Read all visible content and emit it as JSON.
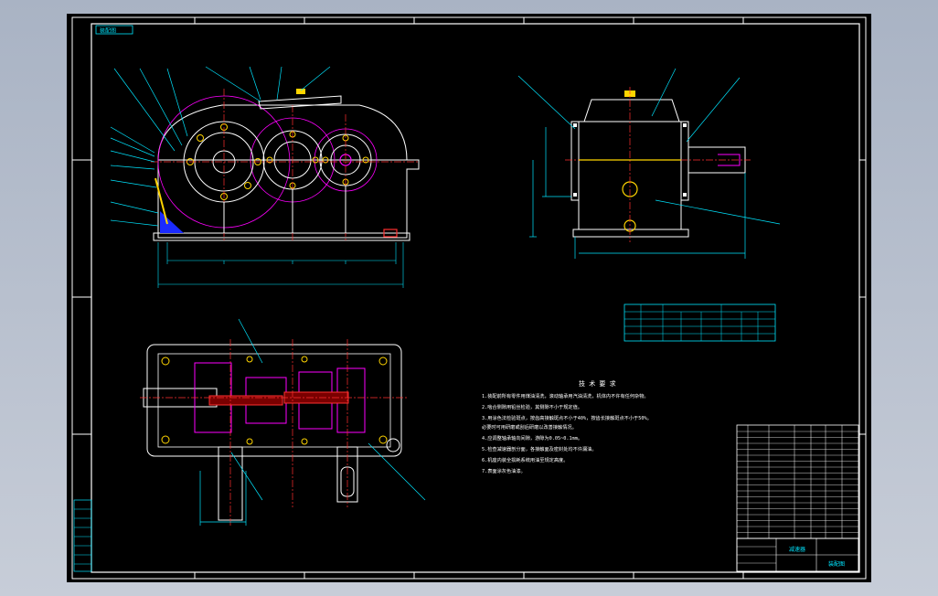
{
  "drawing": {
    "top_left_label": "装配图",
    "title_block_name": "减速器",
    "title_block_sub": "装配图",
    "tech_req_title": "技 术 要 求",
    "tech_req_lines": [
      "1.装配前所有零件用煤油清洗，滚动轴承用汽油清洗，机体内不许有任何杂物。",
      "2.啮合侧隙用铅丝检验，其侧隙不小于规定值。",
      "3.用涂色法检验斑点，按齿高接触斑点不小于40%，按齿长接触斑点不小于50%。",
      "  必要时可用研磨或刮后研磨以改善接触情况。",
      "4.应调整轴承轴向间隙，游隙为0.05~0.1mm。",
      "5.检查减速器剖分面，各接触面及密封处均不许漏油。",
      "6.机座内装全损耗系统用油至规定高度。",
      "7.表面涂灰色油漆。"
    ]
  },
  "colors": {
    "background": "#000000",
    "frame": "#ffffff",
    "outline": "#ffffff",
    "dimension": "#00e5ff",
    "centerline": "#ff3030",
    "gear_pitch": "#ff00ff",
    "handle": "#ffd500",
    "section_fill": "#1b2bff"
  },
  "icons": [
    "oil-plug-icon",
    "vent-cap-icon",
    "bearing-icon"
  ]
}
